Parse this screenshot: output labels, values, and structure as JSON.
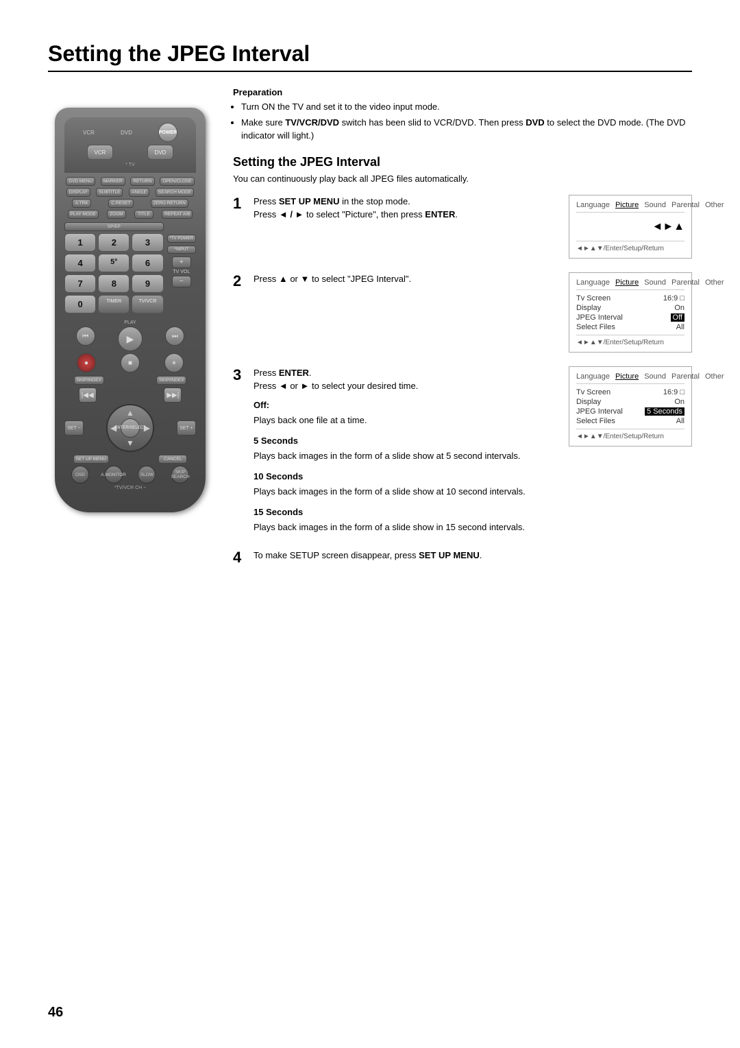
{
  "page": {
    "title": "Setting the JPEG Interval",
    "page_number": "46"
  },
  "preparation": {
    "heading": "Preparation",
    "items": [
      "Turn ON the TV and set it to the video input mode.",
      "Make sure TV/VCR/DVD switch has been slid to VCR/DVD. Then press DVD to select the DVD mode. (The DVD indicator will light.)"
    ]
  },
  "section": {
    "heading": "Setting the JPEG Interval",
    "intro": "You can continuously play back all JPEG files automatically."
  },
  "steps": [
    {
      "num": "1",
      "text_plain": "Press ",
      "text_bold1": "SET UP  MENU",
      "text_after1": " in the stop mode.",
      "text2_plain": "Press ",
      "text2_symbol": "◄ / ►",
      "text2_after": " to select \"Picture\", then press ",
      "text2_bold": "ENTER",
      "screen": {
        "tabs": [
          "Language",
          "Picture",
          "Sound",
          "Parental",
          "Other"
        ],
        "active_tab": "Picture",
        "arrows": "◄►▲",
        "nav": "◄►▲▼/Enter/Setup/Return"
      }
    },
    {
      "num": "2",
      "text_plain": "Press ",
      "text_symbol": "▲",
      "text_or": " or ",
      "text_symbol2": "▼",
      "text_after": " to select \"JPEG Interval\".",
      "screen": {
        "tabs": [
          "Language",
          "Picture",
          "Sound",
          "Parental",
          "Other"
        ],
        "active_tab": "Picture",
        "rows": [
          {
            "label": "Tv Screen",
            "value": "16:9 □"
          },
          {
            "label": "Display",
            "value": "On"
          },
          {
            "label": "JPEG Interval",
            "value": "Off",
            "highlight": true
          },
          {
            "label": "Select Files",
            "value": "All"
          }
        ],
        "nav": "◄►▲▼/Enter/Setup/Return"
      }
    },
    {
      "num": "3",
      "text_plain": "Press ",
      "text_bold": "ENTER",
      "text_after": ".",
      "text2_plain": "Press ",
      "text2_symbol": "◄",
      "text2_or": " or ",
      "text2_symbol2": "►",
      "text2_after": " to select your desired time.",
      "screen": {
        "tabs": [
          "Language",
          "Picture",
          "Sound",
          "Parental",
          "Other"
        ],
        "active_tab": "Picture",
        "rows": [
          {
            "label": "Tv Screen",
            "value": "16:9 □"
          },
          {
            "label": "Display",
            "value": "On"
          },
          {
            "label": "JPEG Interval",
            "value": "5 Seconds",
            "highlight": true
          },
          {
            "label": "Select Files",
            "value": "All"
          }
        ],
        "nav": "◄►▲▼/Enter/Setup/Return"
      }
    }
  ],
  "details": [
    {
      "title": "Off:",
      "text": "Plays back one file at a time."
    },
    {
      "title": "5 Seconds",
      "text": "Plays back images in the form of a slide show at 5 second intervals."
    },
    {
      "title": "10 Seconds",
      "text": "Plays back images in the form of a slide show at 10 second intervals."
    },
    {
      "title": "15 Seconds",
      "text": "Plays back images in the form of a slide show in 15 second intervals."
    }
  ],
  "step4": {
    "num": "4",
    "text_plain": "To make SETUP screen disappear, press ",
    "text_bold": "SET UP MENU",
    "text_after": "."
  },
  "remote": {
    "vcr_label": "VCR",
    "dvd_label": "DVD",
    "power_label": "POWER",
    "tv_label": "* TV",
    "buttons": {
      "dvd_menu": "DVD MENU",
      "marker": "MARKER",
      "return": "RETURN",
      "open_close": "OPEN/CLOSE",
      "display": "DISPLAY",
      "subtitle": "SUBTITLE",
      "angle": "ANGLE",
      "search_mode": "SEARCH MODE",
      "a_trk": "A.TRK",
      "c_reset": "C.RESET",
      "zero_return": "ZERO RETURN",
      "play_mode": "PLAY MODE",
      "zoom": "ZOOM",
      "title": "TITLE",
      "repeat_ab": "REPEAT A/B",
      "sp_ep": "SP/EP",
      "tv": "* TV",
      "power2": "POWER",
      "input": "* INPUT",
      "tv_vol": "TV VOL",
      "timer": "TIMER",
      "tv_vcr": "TV/VCR",
      "rew": "REW",
      "play": "PLAY",
      "ff": "FF",
      "rec": "REC",
      "stop": "STOP",
      "pause": "PAUSE",
      "skip_index_left": "SKIP/INDEX",
      "skip_index_right": "SKIP/INDEX",
      "set_minus": "SET -",
      "set_plus": "SET +",
      "enter_select": "ENTER/SELECT",
      "set_up_menu": "SET UP MENU",
      "cancel": "CANCEL",
      "osd": "OSD",
      "a_monitor": "A.MONITOR",
      "slow": "SLOW",
      "skip_search": "SKIP/SEARCH"
    }
  }
}
